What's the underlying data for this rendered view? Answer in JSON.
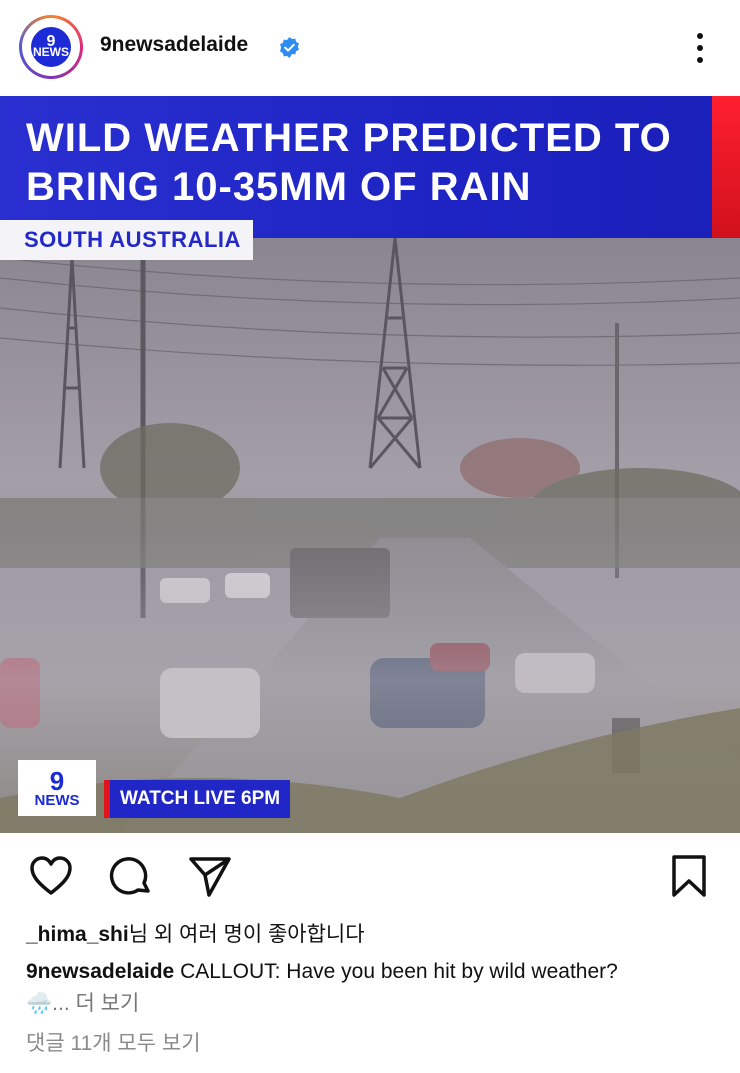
{
  "post": {
    "username": "9newsadelaide",
    "avatar_label": "9",
    "avatar_sub": "NEWS",
    "verified_icon": "verified-badge-icon",
    "menu_icon": "more-options-icon"
  },
  "media": {
    "headline": "WILD WEATHER PREDICTED TO BRING 10-35MM OF RAIN",
    "region": "SOUTH AUSTRALIA",
    "logo_num": "9",
    "logo_text": "NEWS",
    "watch_live": "WATCH LIVE 6PM",
    "banner_color": "#2a2fd0",
    "accent_color": "#e0141e"
  },
  "actions": {
    "like_icon": "heart-icon",
    "comment_icon": "comment-icon",
    "share_icon": "send-icon",
    "save_icon": "bookmark-icon"
  },
  "likes": {
    "user": "_hima_shi",
    "text": "님 외 여러 명이 좋아합니다"
  },
  "caption": {
    "user": "9newsadelaide",
    "text": " CALLOUT: Have you been hit by wild weather?",
    "emoji": "🌧️",
    "ellipsis": "... ",
    "more": "더 보기"
  },
  "comments": {
    "text": "댓글 11개 모두 보기"
  }
}
